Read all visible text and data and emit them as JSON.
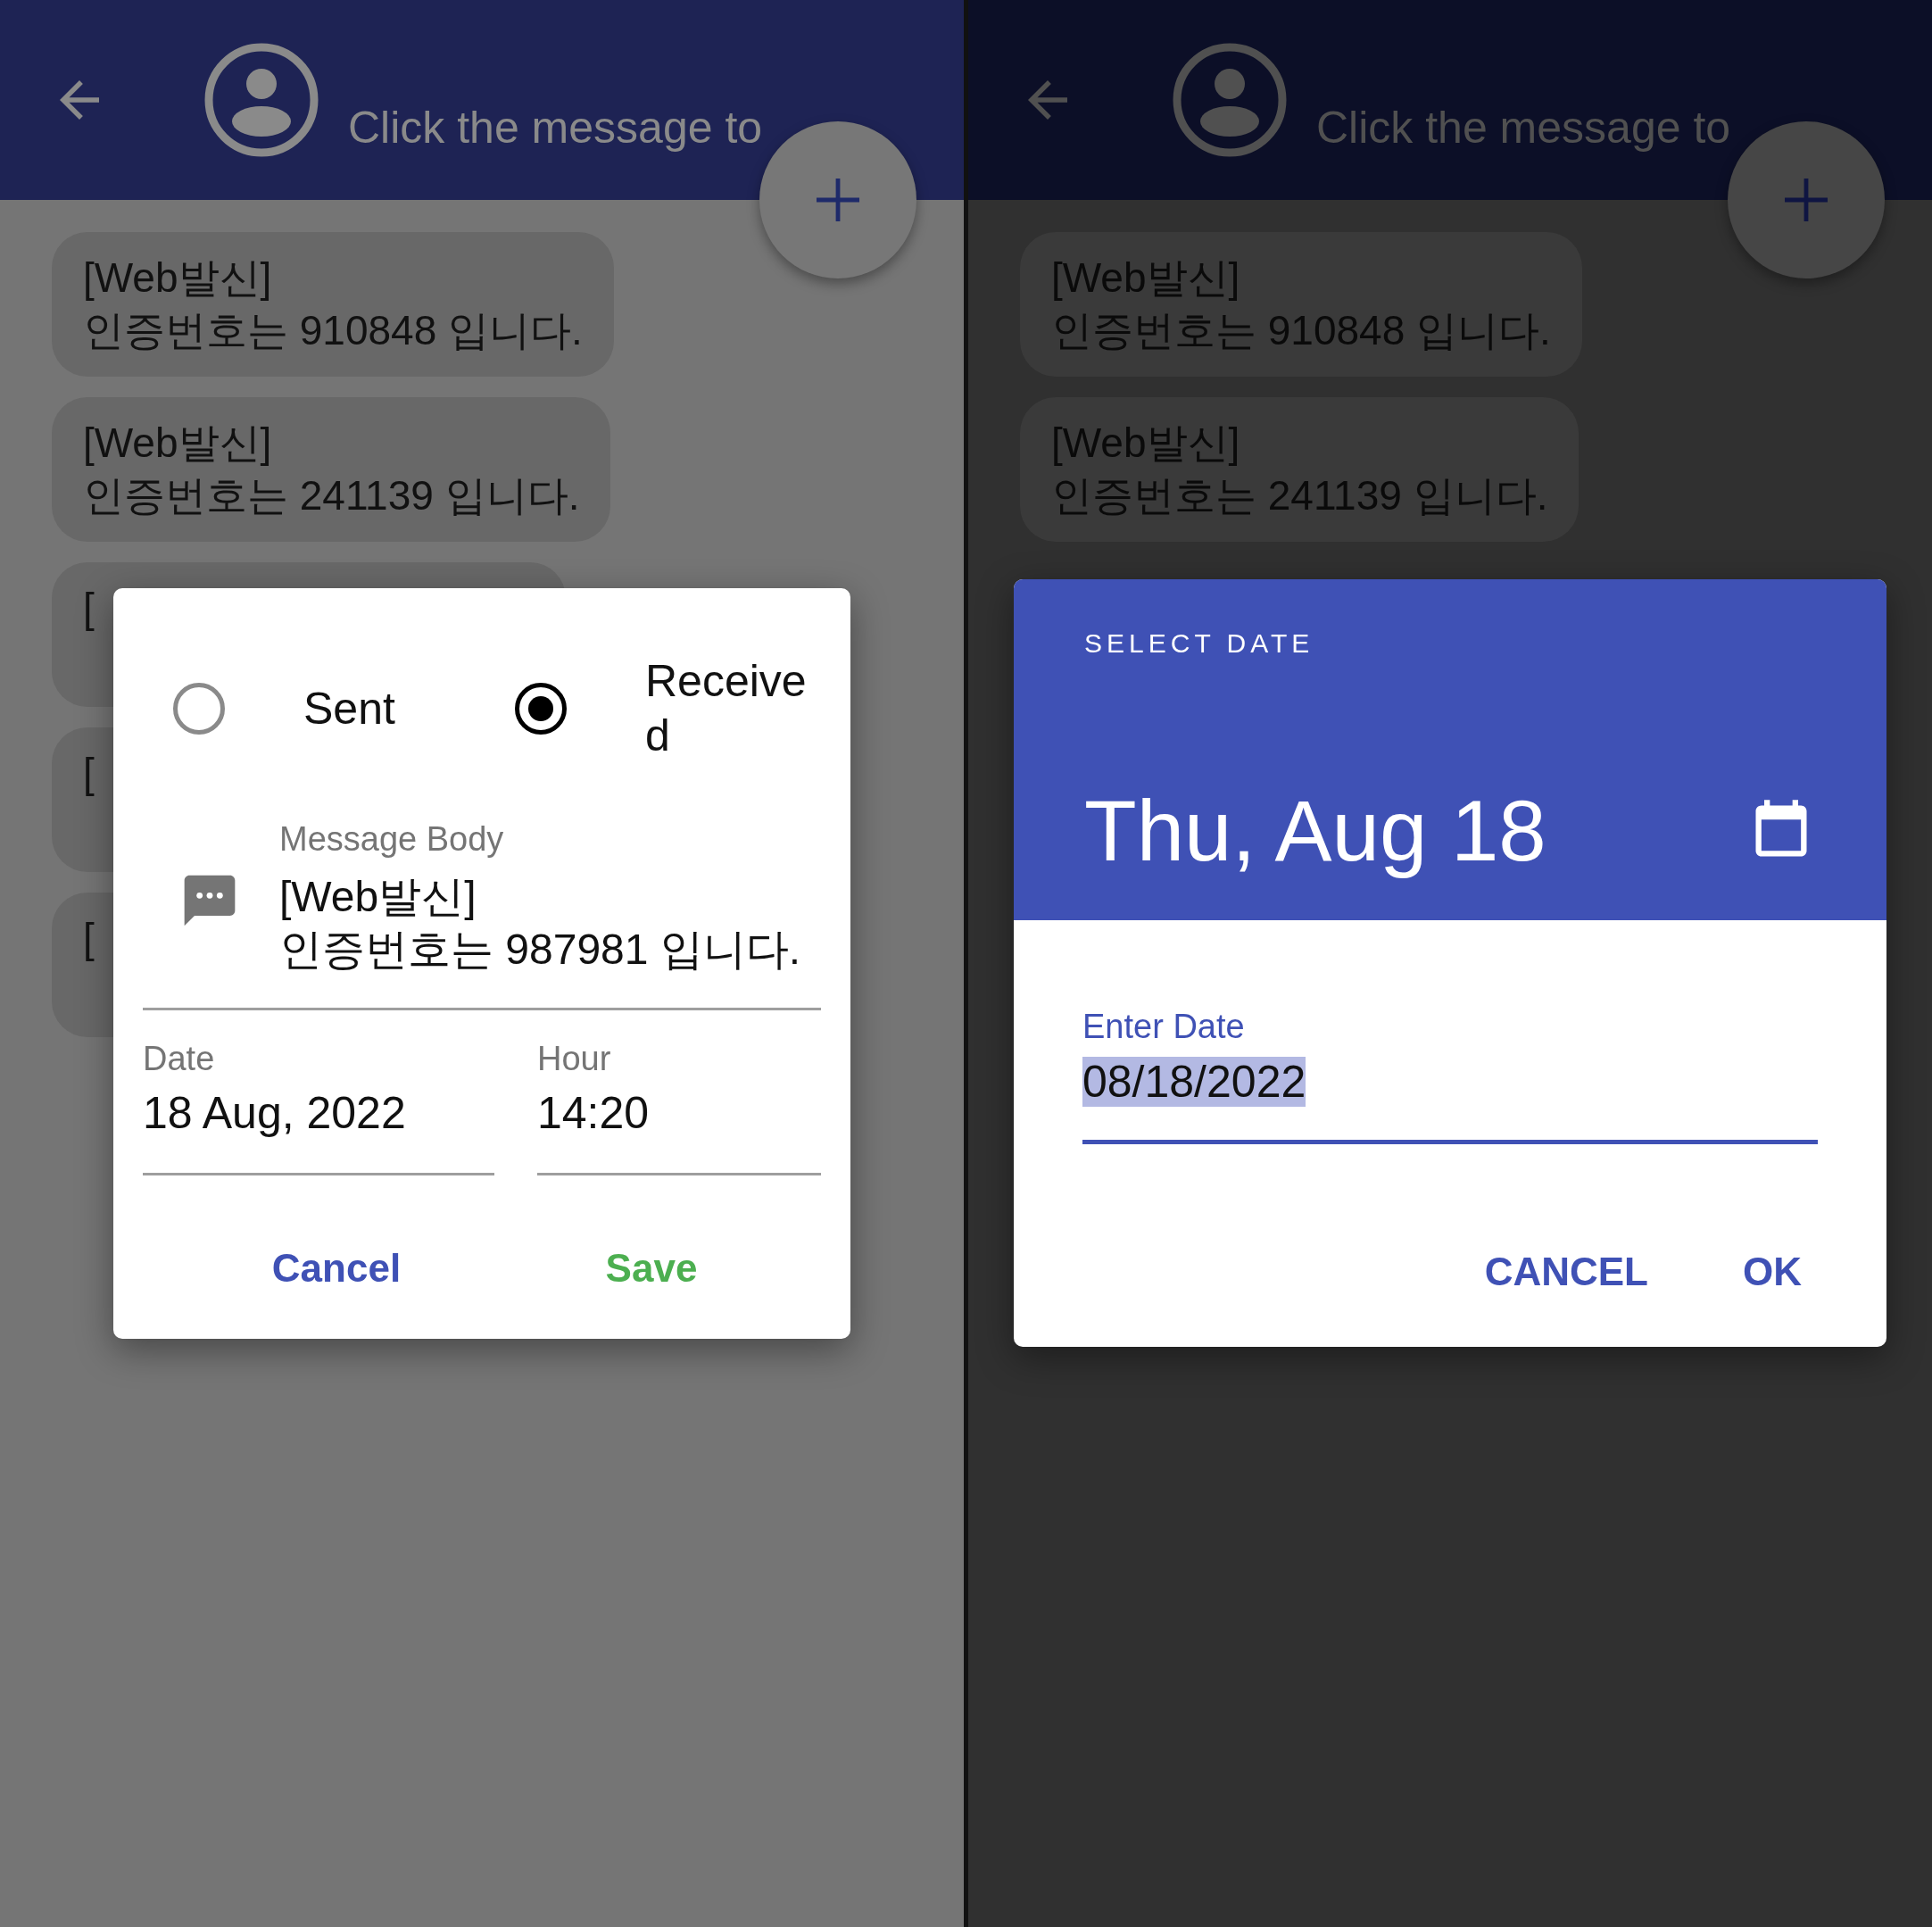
{
  "panels": [
    {
      "kind": "dim",
      "header": {
        "title": "Click the message to"
      },
      "messages": [
        {
          "text": "[Web발신]\n인증번호는 910848 입니다."
        },
        {
          "text": "[Web발신]\n인증번호는 241139 입니다."
        },
        {
          "text": "["
        },
        {
          "text": "["
        },
        {
          "text": "["
        }
      ],
      "dialog": {
        "kind": "edit_message",
        "direction_options": [
          {
            "label": "Sent",
            "selected": false
          },
          {
            "label": "Received",
            "selected": true
          }
        ],
        "body": {
          "label": "Message Body",
          "value": "[Web발신]\n인증번호는 987981 입니다."
        },
        "date": {
          "label": "Date",
          "value": "18 Aug, 2022"
        },
        "hour": {
          "label": "Hour",
          "value": "14:20"
        },
        "buttons": [
          {
            "label": "Cancel",
            "kind": "neutral"
          },
          {
            "label": "Save",
            "kind": "confirm"
          }
        ]
      }
    },
    {
      "kind": "dark",
      "header": {
        "title": "Click the message to"
      },
      "messages": [
        {
          "text": "[Web발신]\n인증번호는 910848 입니다."
        },
        {
          "text": "[Web발신]\n인증번호는 241139 입니다."
        }
      ],
      "dialog": {
        "kind": "date_picker",
        "overline": "SELECT DATE",
        "headline": "Thu, Aug 18",
        "field": {
          "label": "Enter Date",
          "value": "08/18/2022",
          "text_selected": true
        },
        "buttons": [
          {
            "label": "CANCEL",
            "kind": "neutral"
          },
          {
            "label": "OK",
            "kind": "neutral"
          }
        ]
      }
    }
  ]
}
